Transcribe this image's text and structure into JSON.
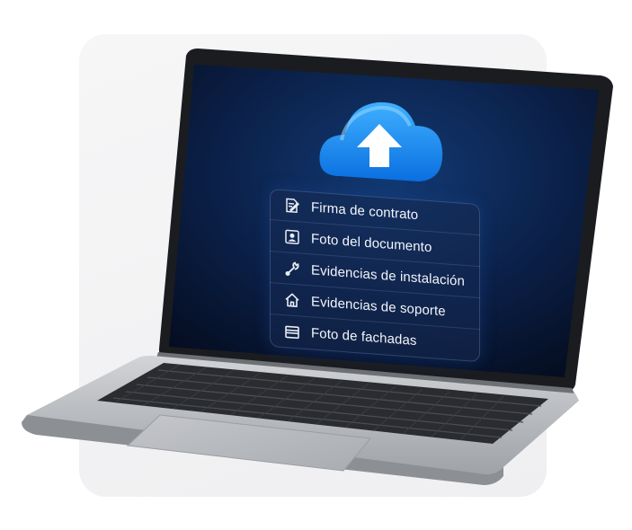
{
  "upload": {
    "icon": "cloud-upload-icon",
    "accent": "#1a8fff"
  },
  "menu": {
    "items": [
      {
        "label": "Firma de contrato",
        "icon": "signature-icon"
      },
      {
        "label": "Foto del documento",
        "icon": "id-card-icon"
      },
      {
        "label": "Evidencias de instalación",
        "icon": "wrench-icon"
      },
      {
        "label": "Evidencias de soporte",
        "icon": "home-icon"
      },
      {
        "label": "Foto de fachadas",
        "icon": "storefront-icon"
      }
    ]
  },
  "colors": {
    "screen_bg": "#0a1a38",
    "menu_text": "#f3f5fa",
    "laptop_body": "#b9bbbf"
  }
}
